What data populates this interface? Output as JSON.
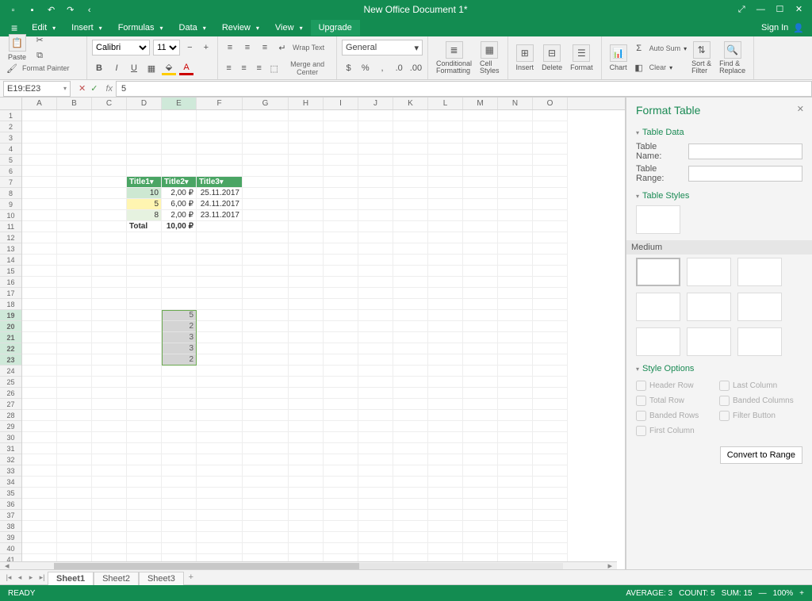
{
  "titlebar": {
    "title": "New Office Document 1*"
  },
  "menubar": {
    "items": [
      "Edit",
      "Insert",
      "Formulas",
      "Data",
      "Review",
      "View"
    ],
    "upgrade": "Upgrade",
    "signin": "Sign In"
  },
  "ribbon": {
    "paste": "Paste",
    "format_painter": "Format Painter",
    "font_name": "Calibri",
    "font_size": "11",
    "wrap_text": "Wrap Text",
    "merge_center": "Merge and Center",
    "number_format": "General",
    "cond_fmt": "Conditional\nFormatting",
    "cell_styles": "Cell\nStyles",
    "insert": "Insert",
    "delete": "Delete",
    "format": "Format",
    "chart": "Chart",
    "autosum": "Auto Sum",
    "clear": "Clear",
    "sort_filter": "Sort &\nFilter",
    "find_replace": "Find &\nReplace"
  },
  "formula": {
    "namebox": "E19:E23",
    "value": "5"
  },
  "columns": [
    "A",
    "B",
    "C",
    "D",
    "E",
    "F",
    "G",
    "H",
    "I",
    "J",
    "K",
    "L",
    "M",
    "N",
    "O"
  ],
  "table": {
    "headers": [
      "Title1",
      "Title2",
      "Title3"
    ],
    "rows": [
      {
        "c0": "10",
        "c1": "2,00 ₽",
        "c2": "25.11.2017"
      },
      {
        "c0": "5",
        "c1": "6,00 ₽",
        "c2": "24.11.2017"
      },
      {
        "c0": "8",
        "c1": "2,00 ₽",
        "c2": "23.11.2017"
      }
    ],
    "total_label": "Total",
    "total_value": "10,00 ₽"
  },
  "selection": {
    "values": [
      "5",
      "2",
      "3",
      "3",
      "2"
    ]
  },
  "panel": {
    "title": "Format Table",
    "sect_data": "Table Data",
    "name_label": "Table Name:",
    "range_label": "Table Range:",
    "sect_styles": "Table Styles",
    "medium": "Medium",
    "sect_options": "Style Options",
    "opts": {
      "header": "Header Row",
      "total": "Total Row",
      "banded_rows": "Banded Rows",
      "first_col": "First Column",
      "last_col": "Last Column",
      "banded_cols": "Banded Columns",
      "filter": "Filter Button"
    },
    "convert": "Convert to Range"
  },
  "sheets": [
    "Sheet1",
    "Sheet2",
    "Sheet3"
  ],
  "status": {
    "ready": "READY",
    "avg": "AVERAGE: 3",
    "count": "COUNT: 5",
    "sum": "SUM: 15",
    "zoom": "100%"
  }
}
